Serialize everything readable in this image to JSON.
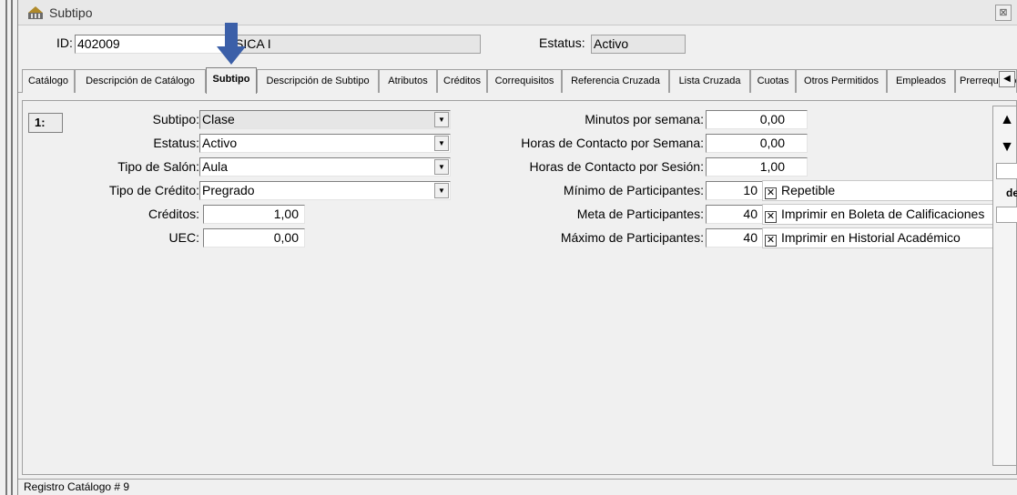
{
  "window": {
    "title": "Subtipo",
    "close_glyph": "⊠"
  },
  "header": {
    "id_label": "ID:",
    "id_value": "402009",
    "name_value": "SICA I",
    "status_label": "Estatus:",
    "status_value": "Activo"
  },
  "tabs": [
    {
      "label": "Catálogo"
    },
    {
      "label": "Descripción de Catálogo"
    },
    {
      "label": "Subtipo"
    },
    {
      "label": "Descripción de Subtipo"
    },
    {
      "label": "Atributos"
    },
    {
      "label": "Créditos"
    },
    {
      "label": "Correquisitos"
    },
    {
      "label": "Referencia Cruzada"
    },
    {
      "label": "Lista Cruzada"
    },
    {
      "label": "Cuotas"
    },
    {
      "label": "Otros Permitidos"
    },
    {
      "label": "Empleados"
    },
    {
      "label": "Prerrequisitos"
    }
  ],
  "tab_scroll_glyph": "◀",
  "record": {
    "number": "1:"
  },
  "left_form": {
    "subtipo_label": "Subtipo:",
    "subtipo_value": "Clase",
    "estatus_label": "Estatus:",
    "estatus_value": "Activo",
    "salon_label": "Tipo de Salón:",
    "salon_value": "Aula",
    "credito_label": "Tipo de Crédito:",
    "credito_value": "Pregrado",
    "creditos_label": "Créditos:",
    "creditos_value": "1,00",
    "uec_label": "UEC:",
    "uec_value": "0,00",
    "dropdown_glyph": "▼"
  },
  "right_form": {
    "minutos_label": "Minutos por semana:",
    "minutos_value": "0,00",
    "horas_semana_label": "Horas de Contacto por Semana:",
    "horas_semana_value": "0,00",
    "horas_sesion_label": "Horas de Contacto por Sesión:",
    "horas_sesion_value": "1,00",
    "minimo_label": "Mínimo de Participantes:",
    "minimo_value": "10",
    "meta_label": "Meta de Participantes:",
    "meta_value": "40",
    "maximo_label": "Máximo de Participantes:",
    "maximo_value": "40",
    "repetible_label": "Repetible",
    "boleta_label": "Imprimir en Boleta de Calificaciones",
    "historial_label": "Imprimir en Historial Académico",
    "check_glyph": "✕"
  },
  "scroll": {
    "up_glyph": "▲",
    "down_glyph": "▼",
    "side_text": "de"
  },
  "status": {
    "text": "Registro Catálogo # 9"
  },
  "colors": {
    "accent_arrow": "#3b5fa8",
    "window_bg": "#f0f0f0"
  }
}
